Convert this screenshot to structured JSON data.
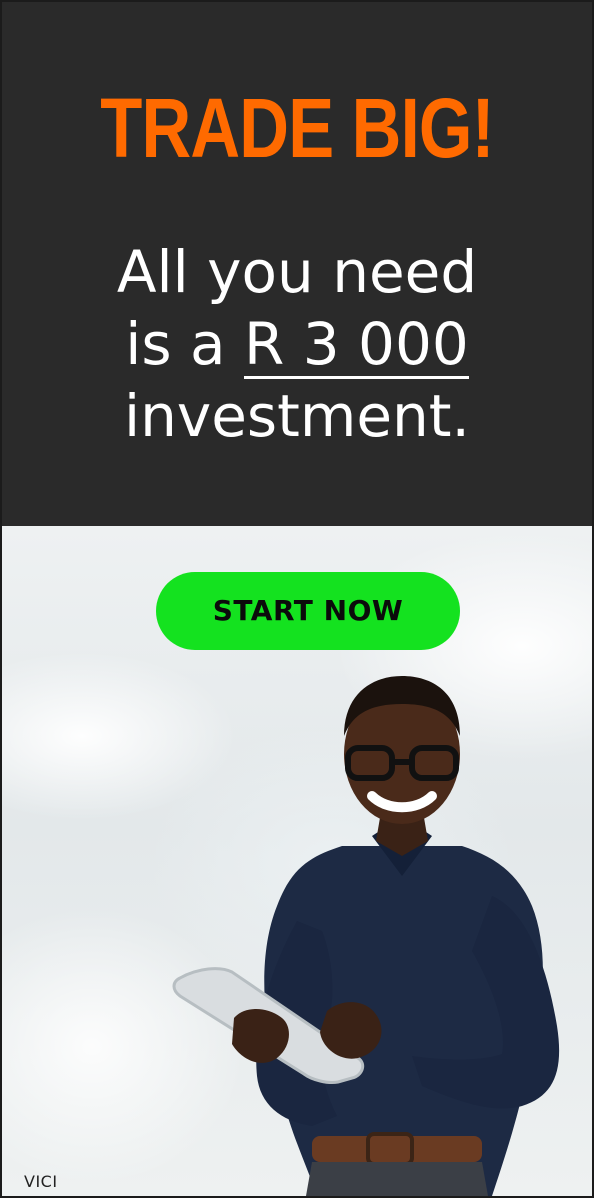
{
  "ad": {
    "headline": "TRADE BIG!",
    "copy_line1": "All you need",
    "copy_line2_prefix": "is a",
    "amount": "R 3 000",
    "copy_line3": "investment.",
    "cta_label": "START NOW",
    "brand": "VICI"
  },
  "colors": {
    "top_background": "#2a2a2a",
    "headline": "#ff6a00",
    "cta_background": "#14e21f",
    "cta_text": "#0b0b0b"
  }
}
